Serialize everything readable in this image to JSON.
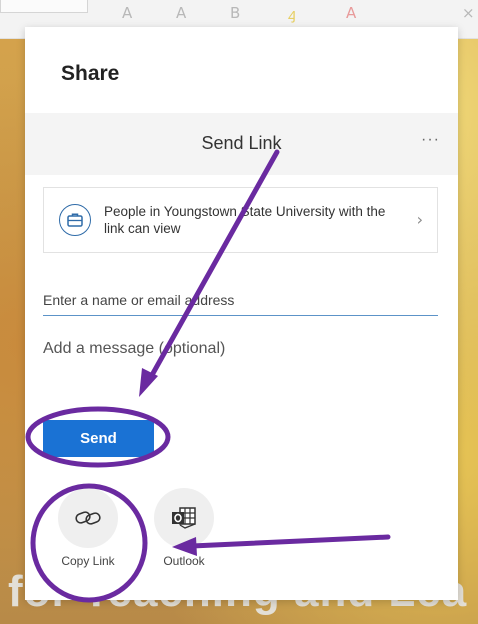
{
  "share_panel": {
    "title": "Share",
    "header_title": "Send Link",
    "more_label": "···",
    "permission": {
      "text": "People in Youngstown State University with the link can view",
      "icon": "briefcase-icon",
      "chevron": "›"
    },
    "recipient_input": {
      "placeholder": "Enter a name or email address",
      "value": ""
    },
    "message_input": {
      "placeholder": "Add a message (optional)",
      "value": ""
    },
    "send_label": "Send",
    "share_options": [
      {
        "label": "Copy Link",
        "icon": "link-icon"
      },
      {
        "label": "Outlook",
        "icon": "outlook-icon"
      }
    ]
  },
  "background": {
    "slide_text": "for Teaching and Lea"
  },
  "colors": {
    "accent": "#1a72d4",
    "annotation": "#6a2aa0",
    "panel_bg": "#ffffff",
    "header_bg": "#f4f4f4"
  }
}
